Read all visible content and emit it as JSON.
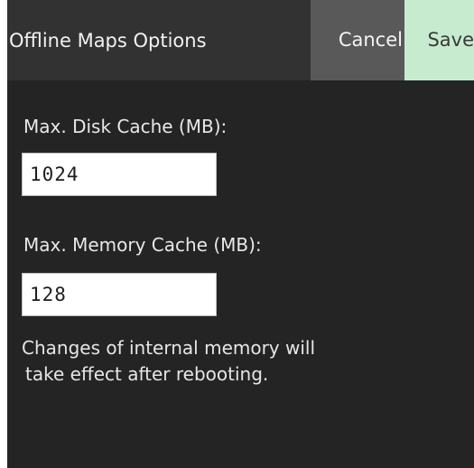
{
  "header": {
    "title": "Offline Maps Options",
    "cancel_label": "Cancel",
    "save_label": "Save"
  },
  "form": {
    "disk_cache": {
      "label": "Max. Disk Cache (MB):",
      "value": "1024"
    },
    "memory_cache": {
      "label": "Max. Memory Cache (MB):",
      "value": "128"
    },
    "note_lines": [
      "Changes of internal memory will",
      "take effect after rebooting."
    ]
  },
  "colors": {
    "background": "#242424",
    "header": "#323232",
    "cancel_button": "#595959",
    "save_button": "#c7ebcf"
  }
}
